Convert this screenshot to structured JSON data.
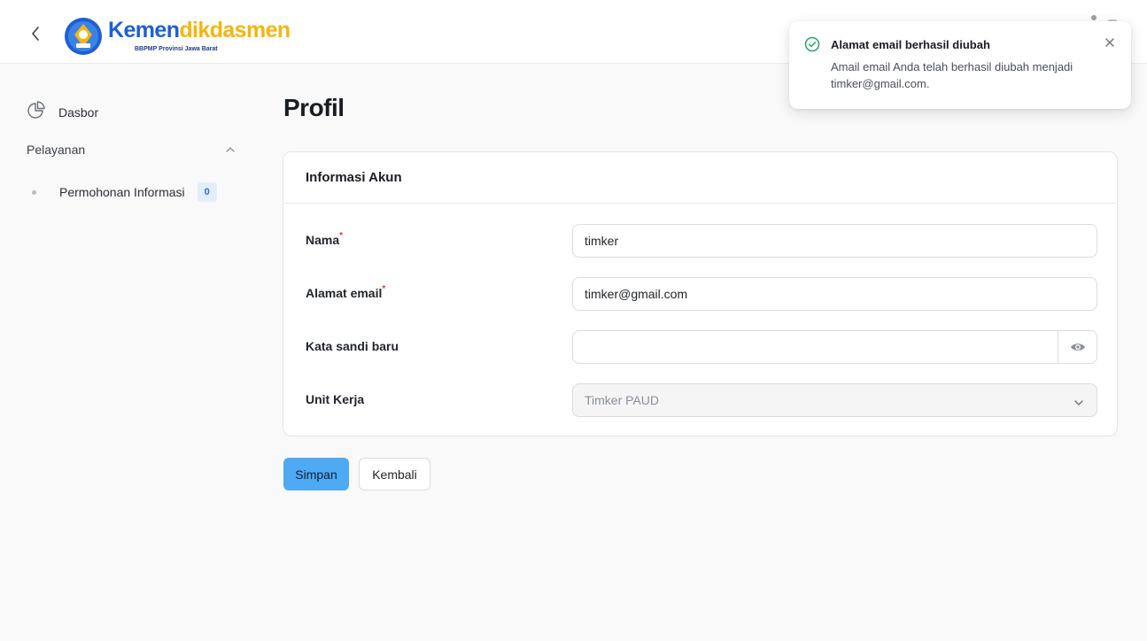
{
  "header": {
    "brand_part1": "Kemen",
    "brand_part2": "dikdasmen",
    "brand_sub": "BBPMP Provinsi Jawa Barat"
  },
  "sidebar": {
    "dasbor_label": "Dasbor",
    "section_label": "Pelayanan",
    "sub_items": [
      {
        "label": "Permohonan Informasi",
        "badge": "0"
      }
    ]
  },
  "main": {
    "page_title": "Profil",
    "card_title": "Informasi Akun",
    "fields": {
      "nama": {
        "label": "Nama",
        "value": "timker",
        "required": "*"
      },
      "email": {
        "label": "Alamat email",
        "value": "timker@gmail.com",
        "required": "*"
      },
      "password": {
        "label": "Kata sandi baru",
        "value": ""
      },
      "unit": {
        "label": "Unit Kerja",
        "value": "Timker PAUD"
      }
    },
    "buttons": {
      "save": "Simpan",
      "back": "Kembali"
    }
  },
  "toast": {
    "title": "Alamat email berhasil diubah",
    "message": "Amail email Anda telah berhasil diubah menjadi timker@gmail.com."
  },
  "colors": {
    "brand_blue": "#1e5fd6",
    "brand_yellow": "#f5b60c",
    "primary_button": "#4eaaf2",
    "success": "#22a86b"
  }
}
